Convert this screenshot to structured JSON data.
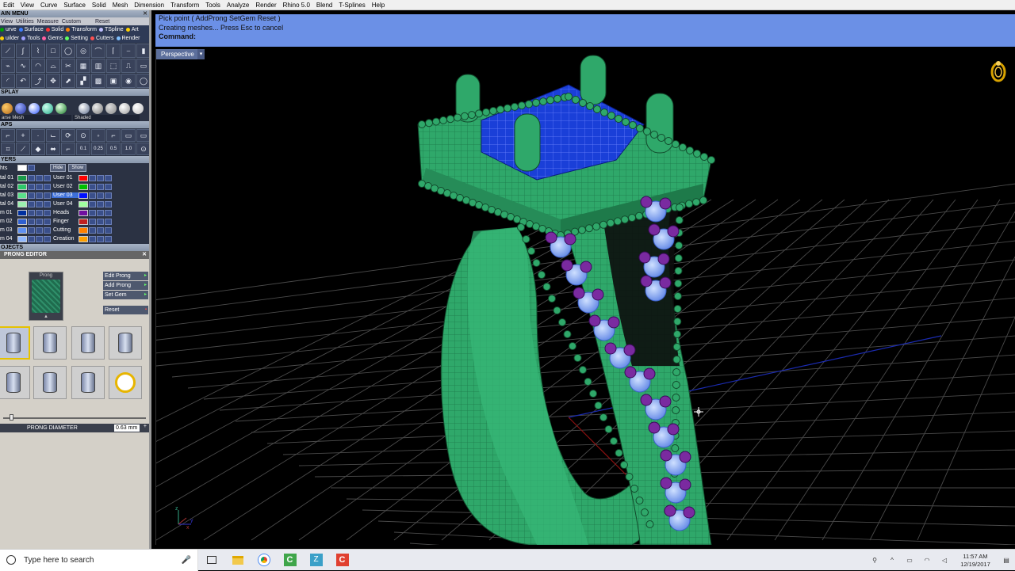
{
  "menubar": [
    "Edit",
    "View",
    "Curve",
    "Surface",
    "Solid",
    "Mesh",
    "Dimension",
    "Transform",
    "Tools",
    "Analyze",
    "Render",
    "Rhino 5.0",
    "Blend",
    "T-Splines",
    "Help"
  ],
  "main_menu": {
    "title": "AIN MENU",
    "tabs": [
      "View",
      "Utilities",
      "Measure",
      "Custom",
      "Reset"
    ],
    "row1": [
      {
        "label": "urve",
        "color": "#00a000"
      },
      {
        "label": "Surface",
        "color": "#3c7cff"
      },
      {
        "label": "Solid",
        "color": "#ff3030"
      },
      {
        "label": "Transform",
        "color": "#ff8000"
      },
      {
        "label": "TSpline",
        "color": "#c0c0ff"
      },
      {
        "label": "Art",
        "color": "#ffd000"
      }
    ],
    "row2": [
      {
        "label": "uilder",
        "color": "#ffd000"
      },
      {
        "label": "Tools",
        "color": "#a0a0ff"
      },
      {
        "label": "Gems",
        "color": "#ff60a0"
      },
      {
        "label": "Setting",
        "color": "#60ff60"
      },
      {
        "label": "Cutters",
        "color": "#ff5050"
      },
      {
        "label": "Render",
        "color": "#80c0ff"
      }
    ]
  },
  "display": {
    "title": "SPLAY",
    "mode_left": "arse Mesh",
    "mode_right": "Shaded"
  },
  "snaps": {
    "title": "APS",
    "values": [
      "0.1",
      "0.25",
      "0.5",
      "1.0"
    ]
  },
  "layers": {
    "title": "YERS",
    "header_left": "hts",
    "hide_label": "Hide",
    "show_label": "Show",
    "rows": [
      {
        "left": "tal 01",
        "left_color": "#1a9a4a",
        "right": "User 01",
        "right_color": "#ff0000",
        "selected": false
      },
      {
        "left": "tal 02",
        "left_color": "#2dc86a",
        "right": "User 02",
        "right_color": "#00c000",
        "selected": false
      },
      {
        "left": "tal 03",
        "left_color": "#5ae08a",
        "right": "User 03",
        "right_color": "#0010ff",
        "selected": true
      },
      {
        "left": "tal 04",
        "left_color": "#9cf0b0",
        "right": "User 04",
        "right_color": "#a0ffa0",
        "selected": false
      },
      {
        "left": "m 01",
        "left_color": "#0030a0",
        "right": "Heads",
        "right_color": "#7010a0",
        "selected": false
      },
      {
        "left": "m 02",
        "left_color": "#3060d0",
        "right": "Finger",
        "right_color": "#c02020",
        "selected": false
      },
      {
        "left": "m 03",
        "left_color": "#6090f0",
        "right": "Cutting",
        "right_color": "#ff8000",
        "selected": false
      },
      {
        "left": "m 04",
        "left_color": "#90b8ff",
        "right": "Creation",
        "right_color": "#ffa000",
        "selected": false
      }
    ]
  },
  "objects": {
    "title": "OJECTS"
  },
  "prong_editor": {
    "title": "PRONG EDITOR",
    "thumb_label": "Prong",
    "menu": [
      "Edit Prong",
      "Add Prong",
      "Set Gem",
      "Reset"
    ],
    "diameter_label": "PRONG DIAMETER",
    "diameter_value": "0.63 mm"
  },
  "command": {
    "line1": "Pick point ( AddProng  SetGem  Reset )",
    "line2": "Creating meshes... Press Esc to cancel",
    "prompt": "Command:"
  },
  "viewport": {
    "title": "Perspective",
    "axis_label_z": "z",
    "axis_label_y": "y",
    "axis_label_x": "x"
  },
  "taskbar": {
    "search_placeholder": "Type here to search",
    "time": "11:57 AM",
    "date": "12/19/2017"
  },
  "colors": {
    "ring_green": "#2fa86a",
    "gem_blue": "#1a3fd8",
    "accent_purple": "#7a2aa0",
    "command_bg": "#6b90e6"
  }
}
